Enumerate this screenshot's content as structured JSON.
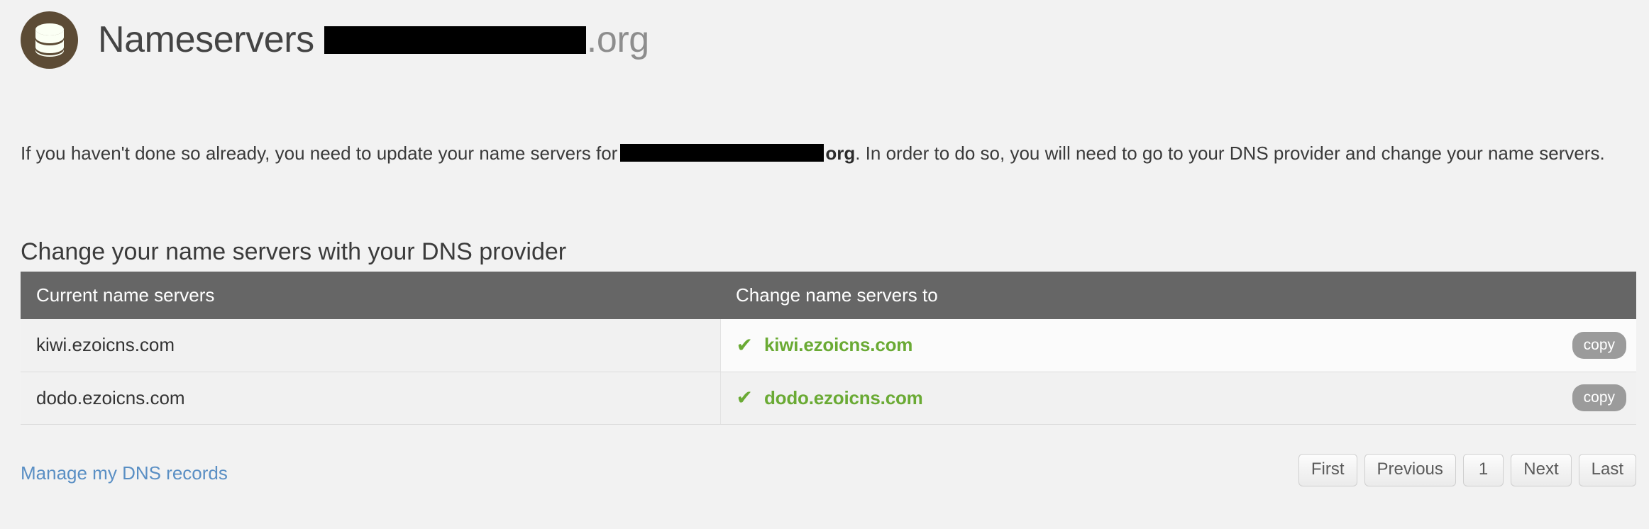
{
  "header": {
    "icon": "database-icon",
    "title": "Nameservers",
    "domain_redacted": "",
    "domain_tld": ".org",
    "badge_color": "#5c4b35"
  },
  "intro": {
    "text_before": "If you haven't done so already, you need to update your name servers for",
    "domain_redacted": "",
    "domain_tld_bold": "org",
    "text_after": ". In order to do so, you will need to go to your DNS provider and change your name servers."
  },
  "section": {
    "heading": "Change your name servers with your DNS provider"
  },
  "table": {
    "columns": [
      "Current name servers",
      "Change name servers to"
    ],
    "header_bg": "#666666",
    "check_color": "#6aaa34",
    "rows": [
      {
        "current": "kiwi.ezoicns.com",
        "target": "kiwi.ezoicns.com",
        "check": "checkmark-icon",
        "copy_label": "copy"
      },
      {
        "current": "dodo.ezoicns.com",
        "target": "dodo.ezoicns.com",
        "check": "checkmark-icon",
        "copy_label": "copy"
      }
    ]
  },
  "footer": {
    "manage_link": "Manage my DNS records",
    "link_color": "#5a8fc4",
    "pagination": {
      "first": "First",
      "previous": "Previous",
      "current_page": "1",
      "next": "Next",
      "last": "Last"
    }
  }
}
